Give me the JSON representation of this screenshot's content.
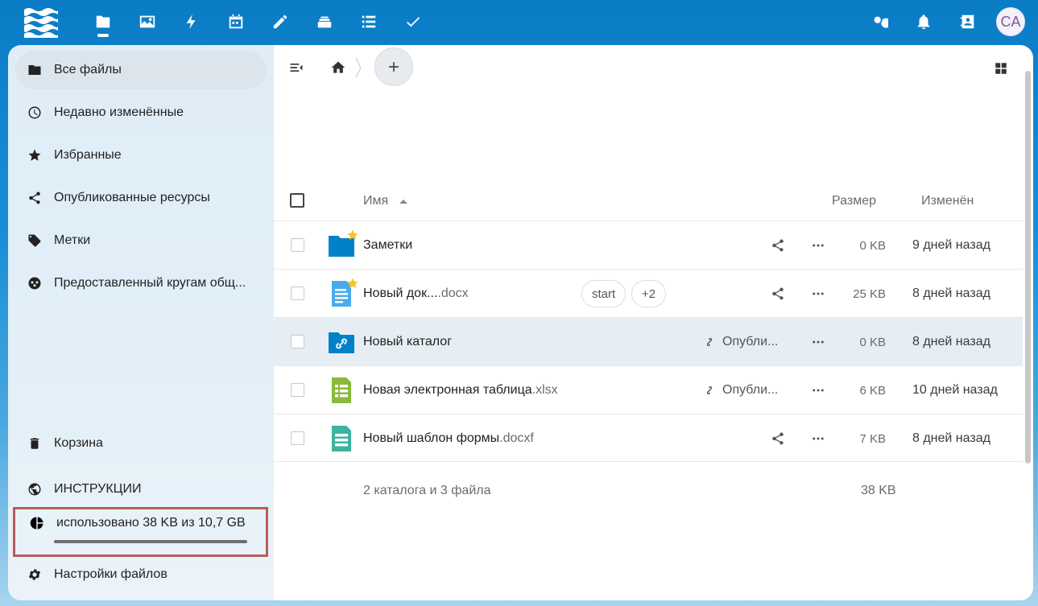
{
  "header": {
    "apps": [
      {
        "name": "files-icon"
      },
      {
        "name": "photos-icon"
      },
      {
        "name": "activity-icon"
      },
      {
        "name": "calendar-icon"
      },
      {
        "name": "notes-icon"
      },
      {
        "name": "deck-icon"
      },
      {
        "name": "tasks-list-icon"
      },
      {
        "name": "checkmark-icon"
      }
    ],
    "avatar_initials": "CA"
  },
  "sidebar": {
    "items": [
      {
        "label": "Все файлы",
        "icon": "folder-icon"
      },
      {
        "label": "Недавно изменённые",
        "icon": "clock-icon"
      },
      {
        "label": "Избранные",
        "icon": "star-icon"
      },
      {
        "label": "Опубликованные ресурсы",
        "icon": "share-icon"
      },
      {
        "label": "Метки",
        "icon": "tag-icon"
      },
      {
        "label": "Предоставленный кругам общ...",
        "icon": "circles-icon"
      }
    ],
    "bottom": {
      "trash": "Корзина",
      "instructions": "ИНСТРУКЦИИ",
      "quota": "использовано 38 KB из 10,7 GB",
      "quota_fraction": 4e-06,
      "settings": "Настройки файлов"
    }
  },
  "table": {
    "headers": {
      "name": "Имя",
      "size": "Размер",
      "modified": "Изменён"
    },
    "rows": [
      {
        "name": "Заметки",
        "ext": "",
        "size": "0 KB",
        "modified": "9 дней назад",
        "type": "folder",
        "favorite": true
      },
      {
        "name": "Новый док... ",
        "ext": ".docx",
        "size": "25 KB",
        "modified": "8 дней назад",
        "type": "document",
        "favorite": true,
        "tags": [
          "start",
          "+2"
        ]
      },
      {
        "name": "Новый каталог",
        "ext": "",
        "size": "0 KB",
        "modified": "8 дней назад",
        "type": "shared-folder",
        "public_label": "Опубли..."
      },
      {
        "name": "Новая электронная таблица",
        "ext": ".xlsx",
        "size": "6 KB",
        "modified": "10 дней назад",
        "type": "spreadsheet",
        "public_label": "Опубли..."
      },
      {
        "name": "Новый шаблон формы",
        "ext": ".docxf",
        "size": "7 KB",
        "modified": "8 дней назад",
        "type": "form"
      }
    ],
    "summary": {
      "count": "2 каталога и 3 файла",
      "size": "38 KB"
    }
  },
  "colors": {
    "header": "#0a7cc6",
    "folder": "#0082c9",
    "doc": "#49abea",
    "sheet": "#8ab93c",
    "form": "#3cb39e",
    "star": "#f5c623"
  }
}
